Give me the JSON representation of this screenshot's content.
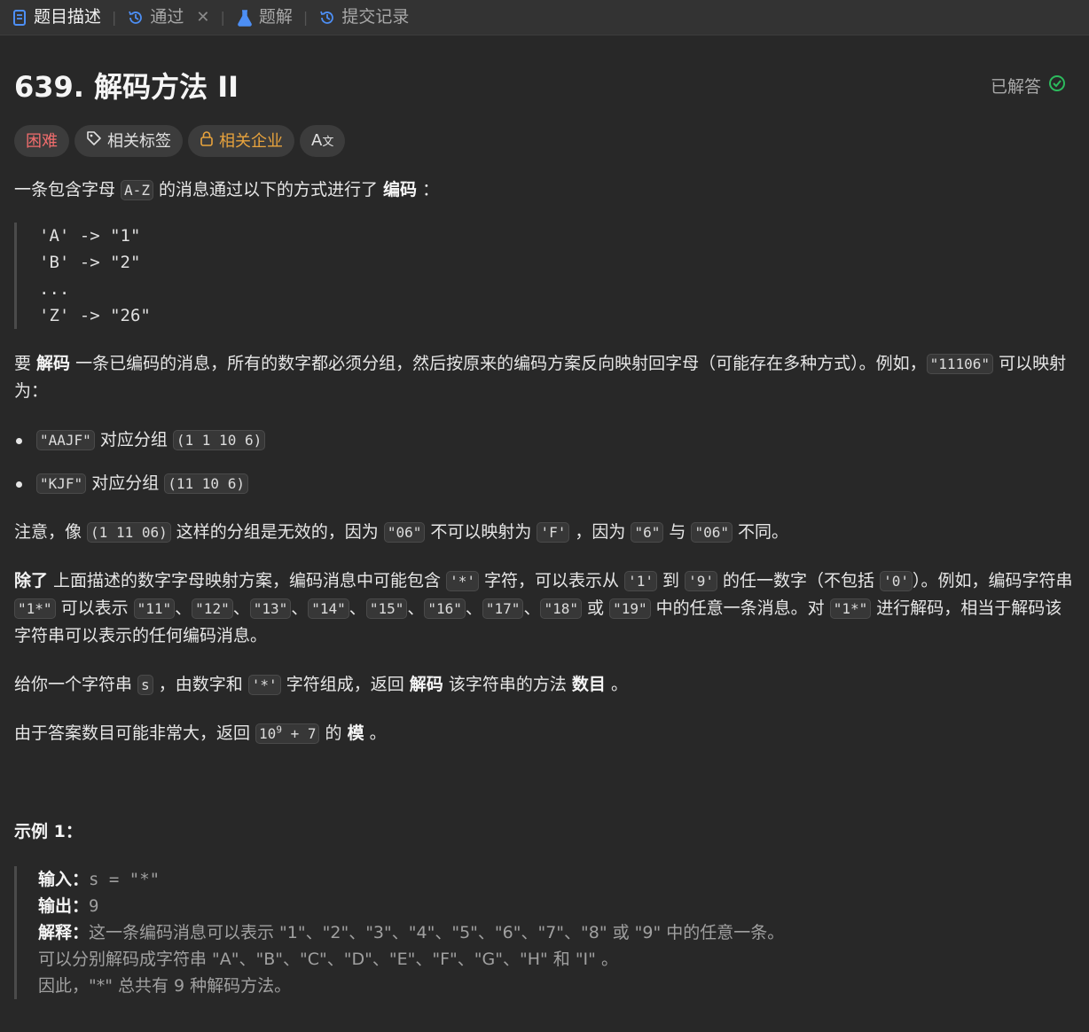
{
  "tabs": [
    {
      "label": "题目描述",
      "icon": "description-icon",
      "active": true
    },
    {
      "label": "通过",
      "icon": "history-icon",
      "closable": true
    },
    {
      "label": "题解",
      "icon": "flask-icon"
    },
    {
      "label": "提交记录",
      "icon": "history-icon"
    }
  ],
  "close_glyph": "✕",
  "problem": {
    "title": "639. 解码方法 II",
    "status": "已解答",
    "tags": {
      "difficulty": "困难",
      "related_tags": "相关标签",
      "related_company": "相关企业",
      "translate": "A文"
    }
  },
  "colors": {
    "hard": "#f16d6d",
    "company": "#e8a33d",
    "solved": "#2cbb5d"
  },
  "desc": {
    "p1": {
      "t1": "一条包含字母 ",
      "c1": "A-Z",
      "t2": " 的消息通过以下的方式进行了 ",
      "b1": "编码",
      "t3": " ："
    },
    "mapping": [
      "'A' -> \"1\"",
      "'B' -> \"2\"",
      "...",
      "'Z' -> \"26\""
    ],
    "p2": {
      "t1": "要 ",
      "b1": "解码",
      "t2": " 一条已编码的消息，所有的数字都必须分组，然后按原来的编码方案反向映射回字母（可能存在多种方式）。例如，",
      "c1": "\"11106\"",
      "t3": " 可以映射为："
    },
    "bullets": [
      {
        "c1": "\"AAJF\"",
        "t1": " 对应分组 ",
        "c2": "(1 1 10 6)"
      },
      {
        "c1": "\"KJF\"",
        "t1": " 对应分组 ",
        "c2": "(11 10 6)"
      }
    ],
    "p3": {
      "t1": "注意，像 ",
      "c1": "(1 11 06)",
      "t2": " 这样的分组是无效的，因为 ",
      "c2": "\"06\"",
      "t3": " 不可以映射为 ",
      "c3": "'F'",
      "t4": " ，因为 ",
      "c4": "\"6\"",
      "t5": " 与 ",
      "c5": "\"06\"",
      "t6": " 不同。"
    },
    "p4": {
      "b1": "除了",
      "t1": " 上面描述的数字字母映射方案，编码消息中可能包含 ",
      "c1": "'*'",
      "t2": " 字符，可以表示从 ",
      "c2": "'1'",
      "t3": " 到 ",
      "c3": "'9'",
      "t4": " 的任一数字（不包括 ",
      "c4": "'0'",
      "t5": "）。例如，编码字符串 ",
      "c5": "\"1*\"",
      "t6": " 可以表示 ",
      "list": [
        "\"11\"",
        "\"12\"",
        "\"13\"",
        "\"14\"",
        "\"15\"",
        "\"16\"",
        "\"17\"",
        "\"18\""
      ],
      "sep": "、",
      "t7": " 或 ",
      "c6": "\"19\"",
      "t8": " 中的任意一条消息。对 ",
      "c7": "\"1*\"",
      "t9": " 进行解码，相当于解码该字符串可以表示的任何编码消息。"
    },
    "p5": {
      "t1": "给你一个字符串 ",
      "c1": "s",
      "t2": " ，由数字和 ",
      "c2": "'*'",
      "t3": " 字符组成，返回 ",
      "b1": "解码",
      "t4": " 该字符串的方法 ",
      "b2": "数目",
      "t5": " 。"
    },
    "p6": {
      "t1": "由于答案数目可能非常大，返回 ",
      "c1_base": "10",
      "c1_exp": "9",
      "c1_rest": " + 7",
      "t2": " 的 ",
      "b1": "模",
      "t3": " 。"
    }
  },
  "example1": {
    "title": "示例 1：",
    "input_label": "输入：",
    "input": "s = \"*\"",
    "output_label": "输出：",
    "output": "9",
    "explain_label": "解释：",
    "explain_lines": [
      "这一条编码消息可以表示 \"1\"、\"2\"、\"3\"、\"4\"、\"5\"、\"6\"、\"7\"、\"8\" 或 \"9\" 中的任意一条。",
      "可以分别解码成字符串 \"A\"、\"B\"、\"C\"、\"D\"、\"E\"、\"F\"、\"G\"、\"H\" 和 \"I\" 。",
      "因此，\"*\" 总共有 9 种解码方法。"
    ]
  }
}
